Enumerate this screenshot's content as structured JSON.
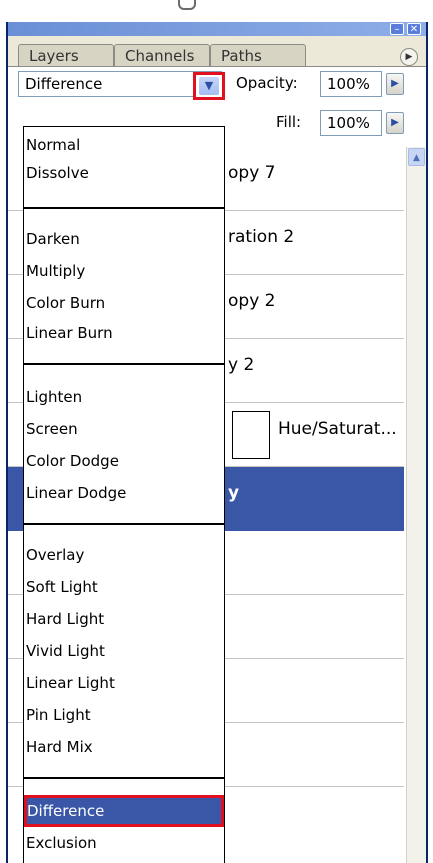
{
  "tabs": [
    {
      "label": "Layers",
      "active": true
    },
    {
      "label": "Channels",
      "active": false
    },
    {
      "label": "Paths",
      "active": false
    }
  ],
  "blend": {
    "value": "Difference"
  },
  "opacity": {
    "label": "Opacity:",
    "value": "100%"
  },
  "fill": {
    "label": "Fill:",
    "value": "100%"
  },
  "layers": [
    {
      "name": "opy 7"
    },
    {
      "name": "ration 2"
    },
    {
      "name": "opy 2"
    },
    {
      "name": "y 2"
    },
    {
      "name": "Hue/Saturat..."
    },
    {
      "name": "y",
      "selected": true
    },
    {
      "name": ""
    },
    {
      "name": ""
    },
    {
      "name": ""
    },
    {
      "name": ""
    }
  ],
  "blend_modes": [
    [
      "Normal",
      "Dissolve"
    ],
    [
      "Darken",
      "Multiply",
      "Color Burn",
      "Linear Burn"
    ],
    [
      "Lighten",
      "Screen",
      "Color Dodge",
      "Linear Dodge"
    ],
    [
      "Overlay",
      "Soft Light",
      "Hard Light",
      "Vivid Light",
      "Linear Light",
      "Pin Light",
      "Hard Mix"
    ],
    [
      "Difference",
      "Exclusion"
    ]
  ],
  "selected_mode": "Difference",
  "colors": {
    "selection": "#3a57a7",
    "highlight_box": "#e0101e"
  }
}
